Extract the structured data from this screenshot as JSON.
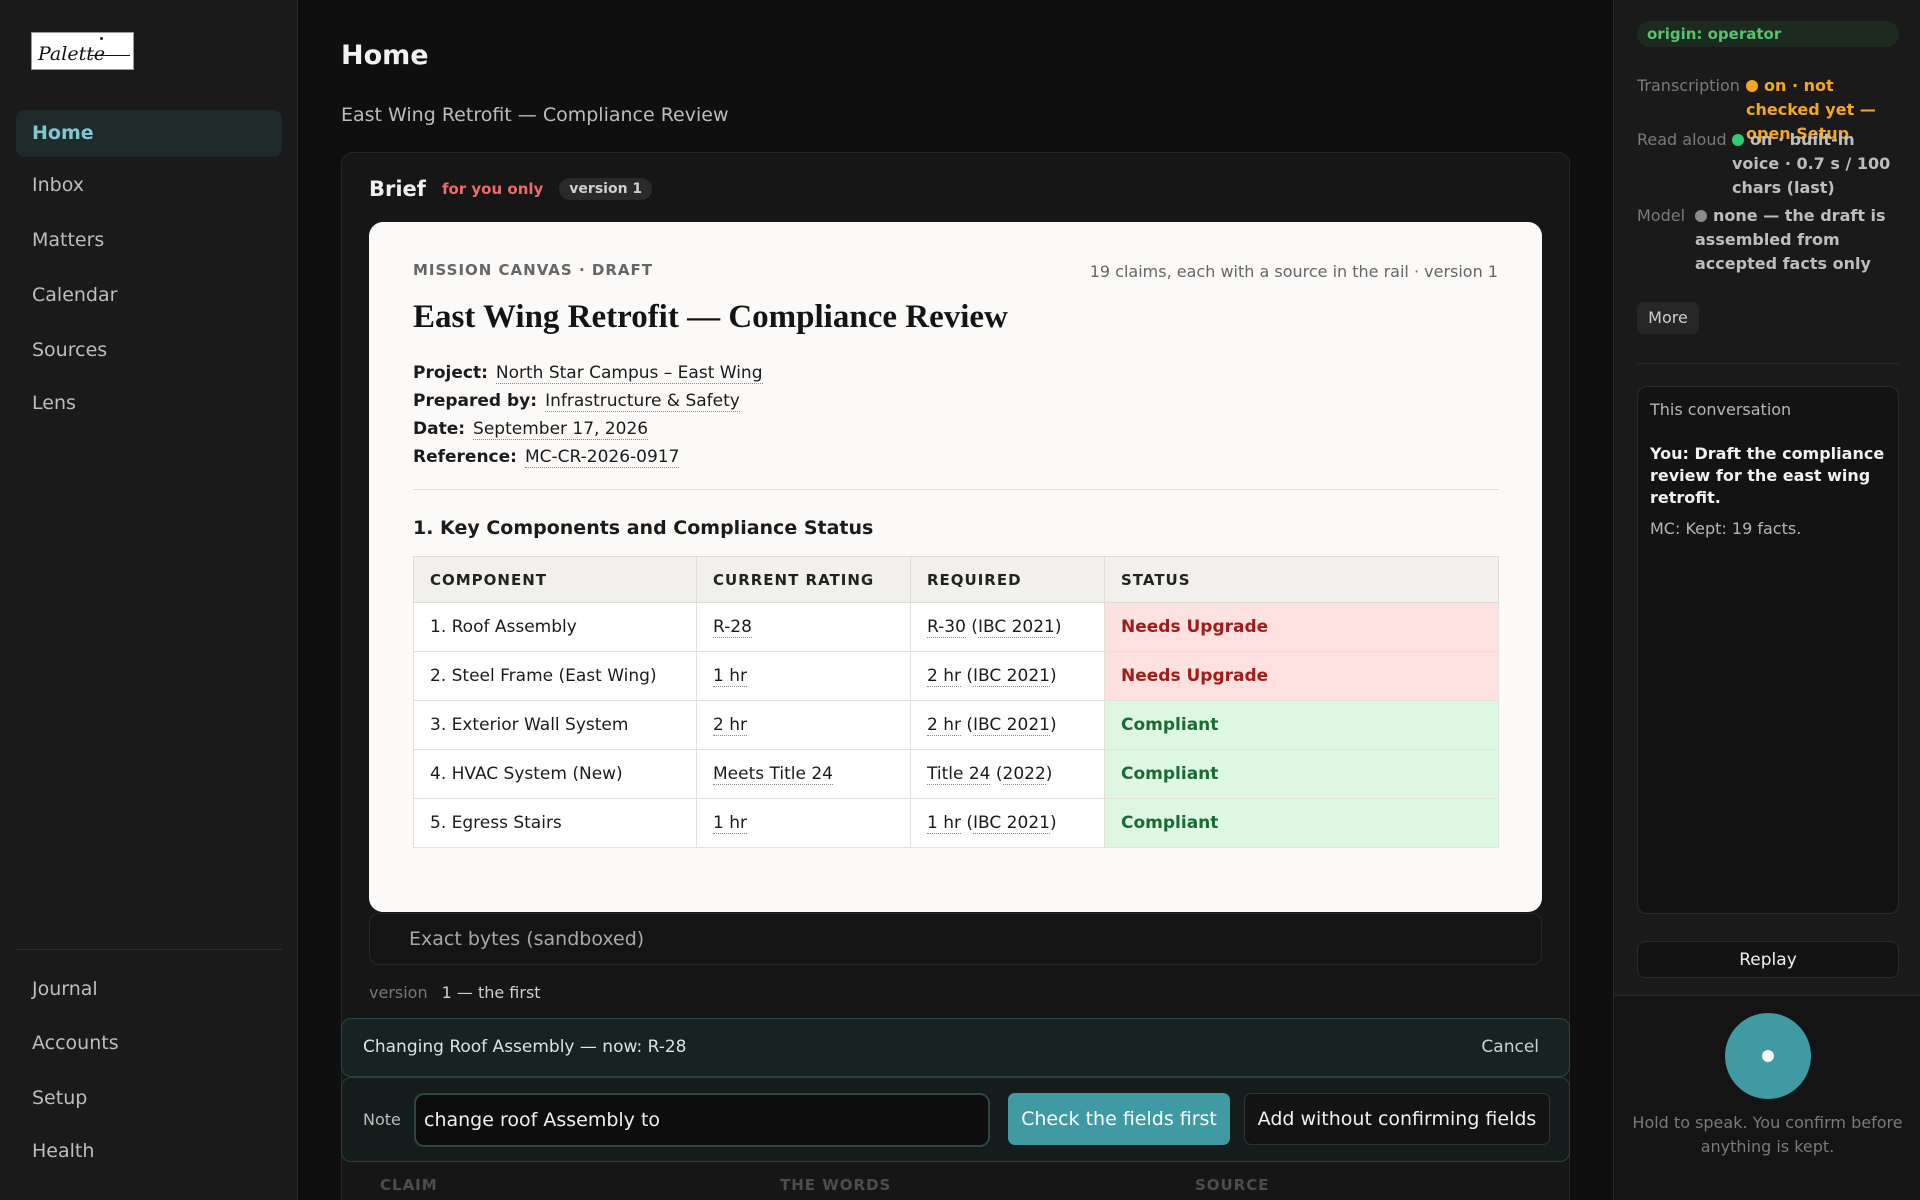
{
  "app": {
    "logo_text": "Palette"
  },
  "sidebar": {
    "items": [
      {
        "label": "Home",
        "active": true
      },
      {
        "label": "Inbox"
      },
      {
        "label": "Matters"
      },
      {
        "label": "Calendar"
      },
      {
        "label": "Sources"
      },
      {
        "label": "Lens"
      }
    ],
    "bottom_items": [
      {
        "label": "Journal"
      },
      {
        "label": "Accounts"
      },
      {
        "label": "Setup"
      },
      {
        "label": "Health"
      }
    ]
  },
  "main": {
    "title": "Home",
    "subtitle": "East Wing Retrofit — Compliance Review",
    "brief": {
      "title": "Brief",
      "privacy_badge": "for you only",
      "version_badge": "version 1"
    },
    "document": {
      "kicker": "MISSION CANVAS · DRAFT",
      "meta": "19 claims, each with a source in the rail · version 1",
      "title": "East Wing Retrofit — Compliance Review",
      "fields": [
        {
          "label": "Project:",
          "value": "North Star Campus – East Wing"
        },
        {
          "label": "Prepared by:",
          "value": "Infrastructure & Safety"
        },
        {
          "label": "Date:",
          "value": "September 17, 2026"
        },
        {
          "label": "Reference:",
          "value": "MC-CR-2026-0917"
        }
      ],
      "section_heading": "1. Key Components and Compliance Status",
      "table": {
        "headers": [
          "COMPONENT",
          "CURRENT RATING",
          "REQUIRED",
          "STATUS"
        ],
        "rows": [
          {
            "component": "1. Roof Assembly",
            "rating": "R-28",
            "required": "R-30",
            "code": "IBC 2021",
            "status": "Needs Upgrade",
            "ok": false
          },
          {
            "component": "2. Steel Frame (East Wing)",
            "rating": "1 hr",
            "required": "2 hr",
            "code": "IBC 2021",
            "status": "Needs Upgrade",
            "ok": false
          },
          {
            "component": "3. Exterior Wall System",
            "rating": "2 hr",
            "required": "2 hr",
            "code": "IBC 2021",
            "status": "Compliant",
            "ok": true
          },
          {
            "component": "4. HVAC System (New)",
            "rating": "Meets Title 24",
            "required": "Title 24",
            "code": "2022",
            "status": "Compliant",
            "ok": true
          },
          {
            "component": "5. Egress Stairs",
            "rating": "1 hr",
            "required": "1 hr",
            "code": "IBC 2021",
            "status": "Compliant",
            "ok": true
          }
        ]
      }
    },
    "sandbox_label": "Exact bytes (sandboxed)",
    "version_row": {
      "key": "version",
      "value": "1 — the first"
    },
    "change_bar": {
      "text": "Changing Roof Assembly — now: R-28",
      "cancel": "Cancel"
    },
    "note": {
      "label": "Note",
      "value": "change roof Assembly to",
      "check_button": "Check the fields first",
      "add_button": "Add without confirming fields"
    },
    "claims_headers": [
      "CLAIM",
      "THE WORDS",
      "SOURCE"
    ]
  },
  "rail": {
    "origin": "origin: operator",
    "status": [
      {
        "key": "Transcription",
        "value": "on · not checked yet — open Setup",
        "color": "#f5a623"
      },
      {
        "key": "Read aloud",
        "value": "on · built-in voice · 0.7 s / 100 chars (last)",
        "color": "#2ecc71"
      },
      {
        "key": "Model",
        "value": "none — the draft is assembled from accepted facts only",
        "color": "#8a8a8a"
      }
    ],
    "more_button": "More",
    "conversation": {
      "heading": "This conversation",
      "you": "You: Draft the compliance review for the east wing retrofit.",
      "mc": "MC: Kept: 19 facts."
    },
    "replay_button": "Replay",
    "hold_text": "Hold to speak. You confirm before anything is kept."
  },
  "colors": {
    "accent": "#3f9aa3",
    "needs_upgrade": "#a11b1b",
    "compliant": "#1a6b33"
  }
}
